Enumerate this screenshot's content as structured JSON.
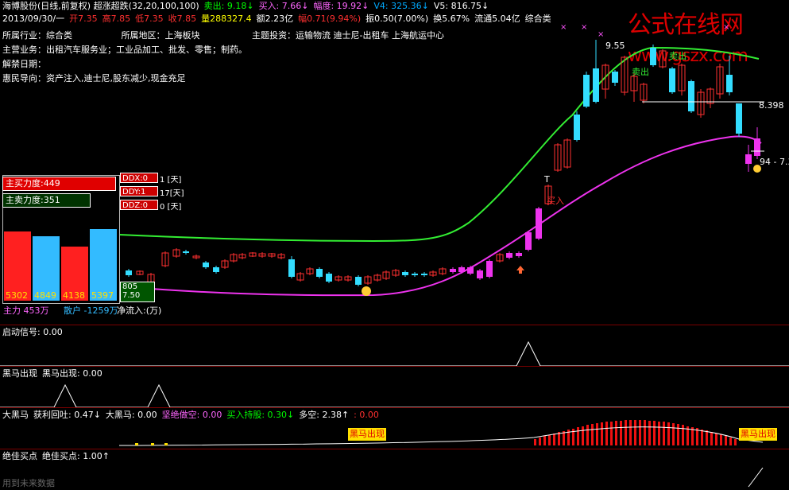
{
  "header": {
    "line1": [
      {
        "text": "海博股份(日线,前复权) 超涨超跌(32,20,100,100)",
        "color": "#ffffff"
      },
      {
        "text": "卖出: 9.18↓",
        "color": "#00ff00"
      },
      {
        "text": "买入: 7.66↓",
        "color": "#ff66ff"
      },
      {
        "text": "幅度: 19.92↓",
        "color": "#ff66ff"
      },
      {
        "text": "V4: 325.36↓",
        "color": "#00aaff"
      },
      {
        "text": "V5: 816.75↓",
        "color": "#ffffff"
      }
    ],
    "line2": [
      {
        "text": "2013/09/30/一",
        "color": "#ffffff"
      },
      {
        "text": "开7.35",
        "color": "#ff3030"
      },
      {
        "text": "高7.85",
        "color": "#ff3030"
      },
      {
        "text": "低7.35",
        "color": "#ff3030"
      },
      {
        "text": "收7.85",
        "color": "#ff3030"
      },
      {
        "text": "量288327.4",
        "color": "#ffff00"
      },
      {
        "text": "额2.23亿",
        "color": "#ffffff"
      },
      {
        "text": "幅0.71(9.94%)",
        "color": "#ff3030"
      },
      {
        "text": "振0.50(7.00%)",
        "color": "#ffffff"
      },
      {
        "text": "换5.67%",
        "color": "#ffffff"
      },
      {
        "text": "流通5.04亿",
        "color": "#ffffff"
      },
      {
        "text": "综合类",
        "color": "#ffffff"
      }
    ]
  },
  "info": {
    "industry": "所属行业：综合类",
    "region": "所属地区：上海板块",
    "theme": "主题投资：运输物流 迪士尼-出租车 上海航运中心",
    "business": "主营业务：出租汽车服务业；工业品加工、批发、零售；制药。",
    "unlock": "解禁日期：",
    "guide": "惠民导向：资产注入,迪士尼,股东减少,现金充足"
  },
  "watermark": {
    "main": "公式在线网",
    "site": "www.gszx.com"
  },
  "chart_labels": {
    "high_price": "9.55",
    "level_price": "8.398",
    "price_right": "94 - 7.3",
    "sell_text": "卖出",
    "sell_text2": "卖出",
    "buy_text": "买入",
    "t_marker": "T",
    "price_left": "805",
    "price_left2": "7.50"
  },
  "left_panel": {
    "buy_force": "主买力度:449",
    "sell_force": "主卖力度:351",
    "bars": [
      {
        "label": "5302",
        "color": "#ff2020",
        "level": 0.82
      },
      {
        "label": "4849",
        "color": "#33bbff",
        "level": 0.76
      },
      {
        "label": "4138",
        "color": "#ff2020",
        "level": 0.64
      },
      {
        "label": "5397",
        "color": "#33bbff",
        "level": 0.84
      }
    ],
    "ddx": [
      {
        "label": "DDX:0",
        "value": "1 [天]"
      },
      {
        "label": "DDY:1",
        "value": "17[天]"
      },
      {
        "label": "DDZ:0",
        "value": "0 [天]"
      }
    ],
    "main_force": "主力 453万",
    "retail": "散户 -1259万",
    "net_inflow": "净流入:(万)"
  },
  "panels": {
    "p1": {
      "title": "启动信号",
      "value": ": 0.00"
    },
    "p2": {
      "title": "黑马出现",
      "sub": "黑马出现: 0.00"
    },
    "p3": {
      "items": [
        {
          "text": "大黑马",
          "color": "#ffffff"
        },
        {
          "text": "获利回吐: 0.47↓",
          "color": "#ffffff"
        },
        {
          "text": "大黑马: 0.00",
          "color": "#ffffff"
        },
        {
          "text": "坚绝做空: 0.00",
          "color": "#ff66ff"
        },
        {
          "text": "买入持股: 0.30↓",
          "color": "#00ff00"
        },
        {
          "text": "多空: 2.38↑",
          "color": "#ffffff"
        },
        {
          "text": ": 0.00",
          "color": "#ff3030"
        }
      ],
      "banner": "黑马出现"
    },
    "p4": {
      "title": "绝佳买点",
      "sub": "绝佳买点: 1.00↑"
    },
    "footer": "用到未来数据"
  },
  "colors": {
    "up": "#ff3030",
    "down": "#33ddff",
    "ma_green": "#33ee33",
    "ma_magenta": "#ee33ee",
    "divider": "#7a0000"
  }
}
